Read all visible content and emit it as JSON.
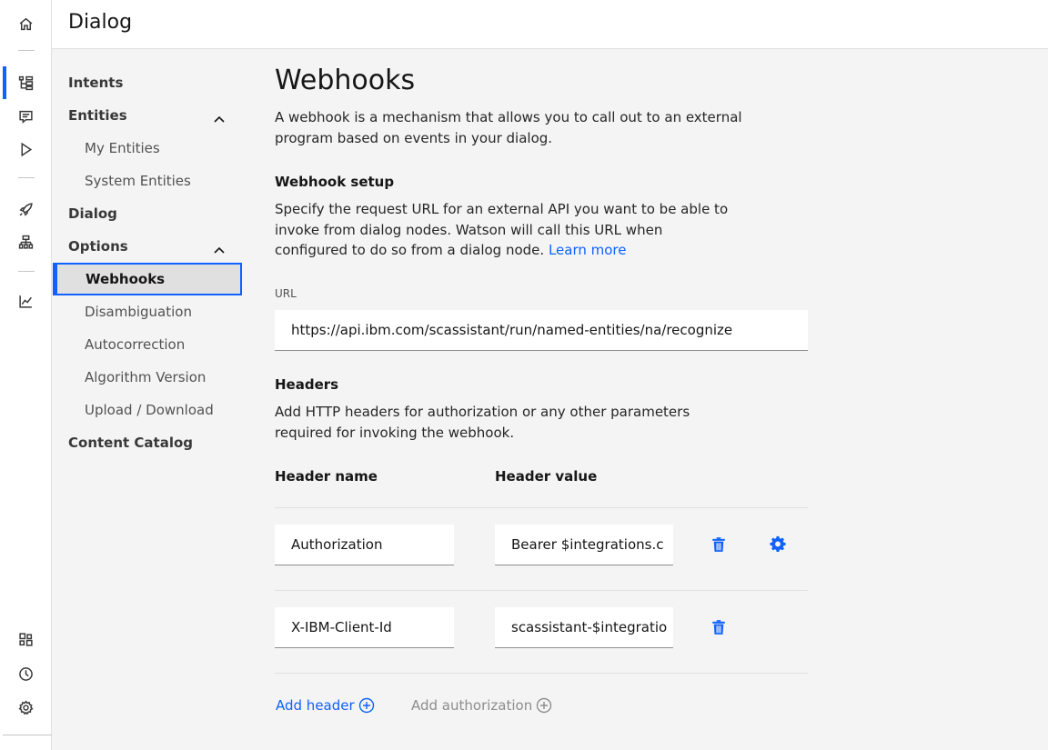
{
  "header": {
    "title": "Dialog"
  },
  "rail": {
    "icons": [
      "home-icon",
      "dialog-tree-icon",
      "chat-icon",
      "play-icon",
      "rocket-icon",
      "hierarchy-icon",
      "analytics-icon",
      "apps-icon",
      "history-icon",
      "settings-icon"
    ],
    "active": "dialog-tree-icon"
  },
  "nav": {
    "items": [
      {
        "label": "Intents"
      },
      {
        "label": "Entities"
      },
      {
        "label": "My Entities"
      },
      {
        "label": "System Entities"
      },
      {
        "label": "Dialog"
      },
      {
        "label": "Options"
      },
      {
        "label": "Webhooks"
      },
      {
        "label": "Disambiguation"
      },
      {
        "label": "Autocorrection"
      },
      {
        "label": "Algorithm Version"
      },
      {
        "label": "Upload / Download"
      },
      {
        "label": "Content Catalog"
      }
    ],
    "selected": "Webhooks"
  },
  "main": {
    "title": "Webhooks",
    "description": "A webhook is a mechanism that allows you to call out to an external program based on events in your dialog.",
    "setup": {
      "heading": "Webhook setup",
      "description": "Specify the request URL for an external API you want to be able to invoke from dialog nodes. Watson will call this URL when configured to do so from a dialog node.",
      "learn_more": "Learn more",
      "url_label": "URL",
      "url_value": "https://api.ibm.com/scassistant/run/named-entities/na/recognize"
    },
    "headers": {
      "heading": "Headers",
      "description": "Add HTTP headers for authorization or any other parameters required for invoking the webhook.",
      "col_name": "Header name",
      "col_value": "Header value",
      "rows": [
        {
          "name": "Authorization",
          "value": "Bearer $integrations.c"
        },
        {
          "name": "X-IBM-Client-Id",
          "value": "scassistant-$integratio"
        }
      ],
      "add_header": "Add header",
      "add_authorization": "Add authorization"
    }
  },
  "colors": {
    "accent": "#0f62fe",
    "disabled": "#8d8d8d",
    "background": "#f4f4f4"
  }
}
